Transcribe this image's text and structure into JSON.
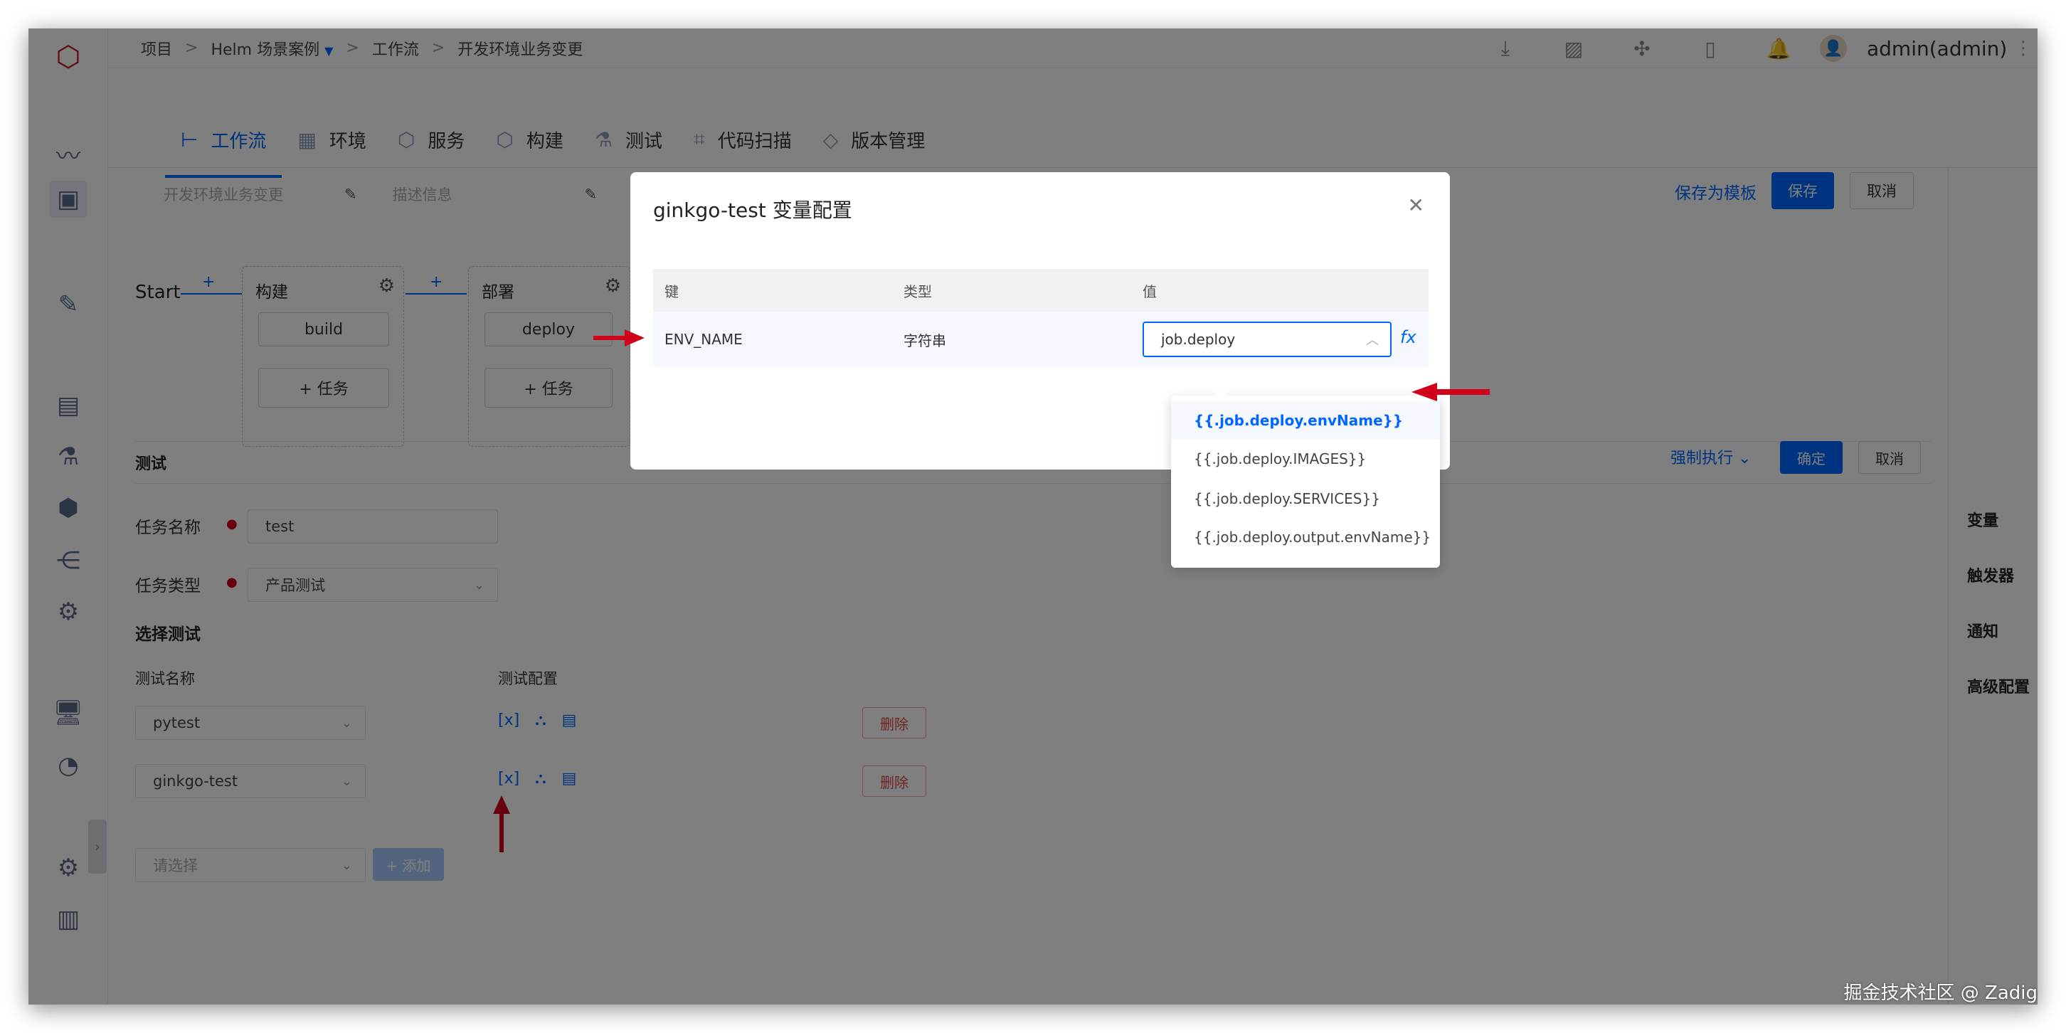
{
  "breadcrumb": {
    "items": [
      "项目",
      "Helm 场景案例",
      "工作流",
      "开发环境业务变更"
    ],
    "sep": ">"
  },
  "user": {
    "name": "admin(admin)"
  },
  "tabs": [
    {
      "label": "工作流",
      "icon": "workflow-icon"
    },
    {
      "label": "环境",
      "icon": "environment-icon"
    },
    {
      "label": "服务",
      "icon": "service-icon"
    },
    {
      "label": "构建",
      "icon": "build-icon"
    },
    {
      "label": "测试",
      "icon": "test-icon"
    },
    {
      "label": "代码扫描",
      "icon": "code-scan-icon"
    },
    {
      "label": "版本管理",
      "icon": "version-icon"
    }
  ],
  "header": {
    "workflow_name": "开发环境业务变更",
    "description_placeholder": "描述信息",
    "save_template": "保存为模板",
    "save": "保存",
    "cancel": "取消"
  },
  "right_panel": [
    "变量",
    "触发器",
    "通知",
    "高级配置"
  ],
  "workflow": {
    "start": "Start",
    "stages": [
      {
        "title": "构建",
        "job": "build",
        "add_task": "+ 任务"
      },
      {
        "title": "部署",
        "job": "deploy",
        "add_task": "+ 任务"
      }
    ]
  },
  "job_panel": {
    "title": "测试",
    "force_run": "强制执行",
    "confirm": "确定",
    "cancel": "取消",
    "task_name_label": "任务名称",
    "task_name_value": "test",
    "task_type_label": "任务类型",
    "task_type_value": "产品测试",
    "select_test_label": "选择测试",
    "col_test_name": "测试名称",
    "col_test_config": "测试配置",
    "tests": [
      {
        "name": "pytest",
        "delete": "删除"
      },
      {
        "name": "ginkgo-test",
        "delete": "删除"
      }
    ],
    "select_placeholder": "请选择",
    "add": "+ 添加"
  },
  "modal": {
    "title": "ginkgo-test 变量配置",
    "columns": [
      "键",
      "类型",
      "值"
    ],
    "row": {
      "key": "ENV_NAME",
      "type": "字符串",
      "value": "job.deploy"
    },
    "options": [
      "{{.job.deploy.envName}}",
      "{{.job.deploy.IMAGES}}",
      "{{.job.deploy.SERVICES}}",
      "{{.job.deploy.output.envName}}"
    ],
    "selected_index": 0
  },
  "watermark": "掘金技术社区 @ Zadig",
  "colors": {
    "accent": "#0066ff",
    "danger": "#e04646",
    "annotation_arrow": "#d0021b",
    "logo": "#c8102e"
  }
}
